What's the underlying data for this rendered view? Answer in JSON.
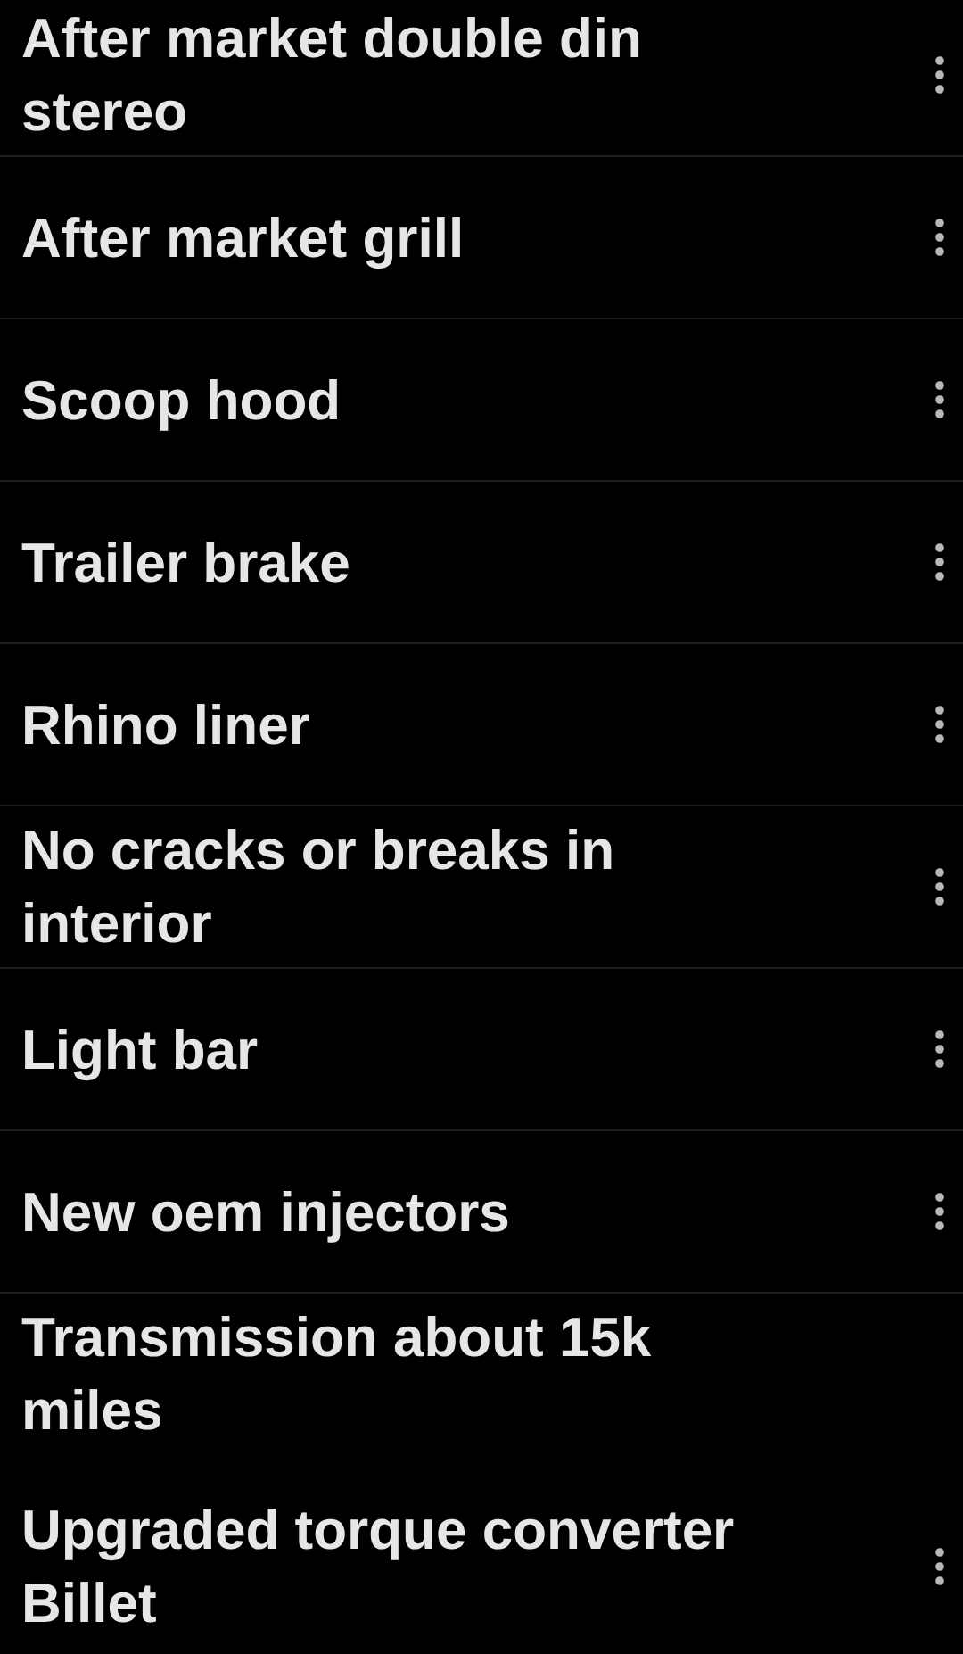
{
  "items": [
    {
      "label": "After market double din stereo",
      "has_menu": true,
      "divider": true
    },
    {
      "label": "After market grill",
      "has_menu": true,
      "divider": true
    },
    {
      "label": "Scoop hood",
      "has_menu": true,
      "divider": true
    },
    {
      "label": "Trailer brake",
      "has_menu": true,
      "divider": true
    },
    {
      "label": "Rhino liner",
      "has_menu": true,
      "divider": true
    },
    {
      "label": "No cracks or breaks in interior",
      "has_menu": true,
      "divider": true
    },
    {
      "label": "Light bar",
      "has_menu": true,
      "divider": true
    },
    {
      "label": "New oem injectors",
      "has_menu": true,
      "divider": true
    },
    {
      "label": "Transmission about 15k miles",
      "has_menu": false,
      "divider": false
    },
    {
      "label": "Upgraded torque converter Billet",
      "has_menu": true,
      "divider": false
    }
  ]
}
